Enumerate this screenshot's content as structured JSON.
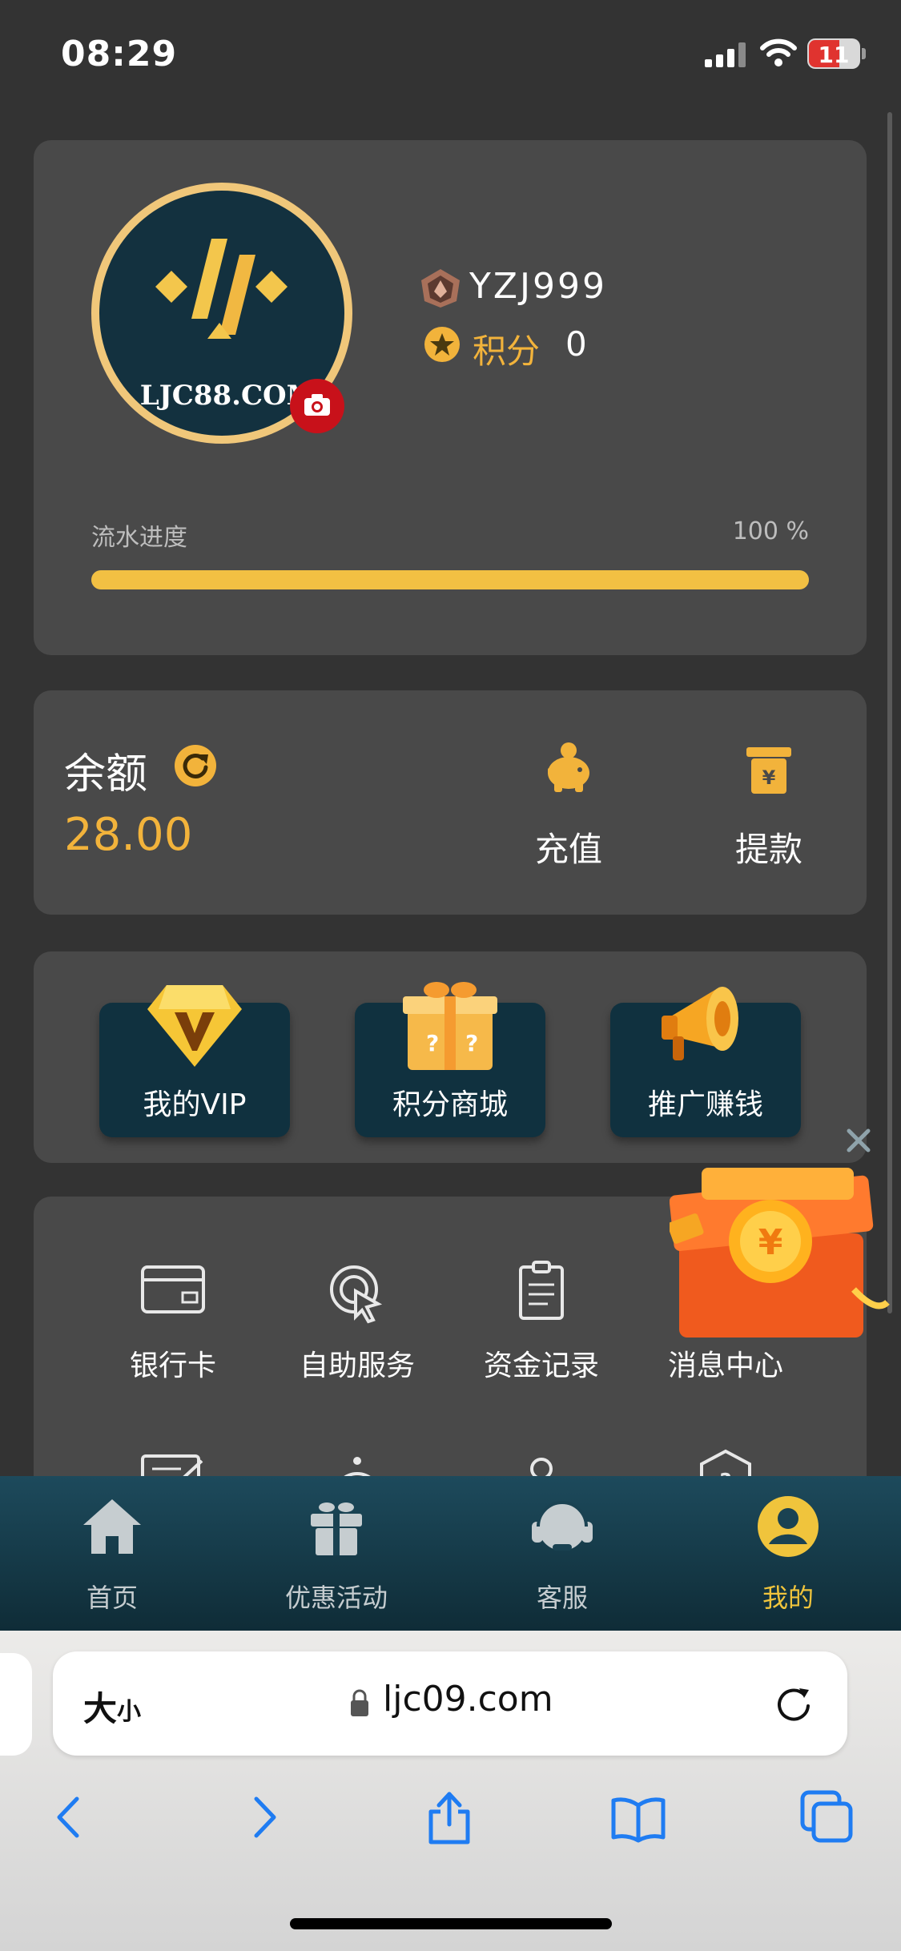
{
  "status_bar": {
    "time": "08:29",
    "battery": "11"
  },
  "profile": {
    "avatar_brand": "LJC88.COM",
    "username": "YZJ999",
    "points_label": "积分",
    "points_value": "0",
    "turnover_label": "流水进度",
    "turnover_percent": "100 %",
    "turnover_progress": 1.0
  },
  "balance": {
    "label": "余额",
    "value": "28.00",
    "deposit_label": "充值",
    "withdraw_label": "提款"
  },
  "features": [
    {
      "label": "我的VIP",
      "icon": "diamond-icon"
    },
    {
      "label": "积分商城",
      "icon": "gift-box-icon"
    },
    {
      "label": "推广赚钱",
      "icon": "megaphone-icon"
    }
  ],
  "menu": [
    {
      "label": "银行卡",
      "icon": "bank-card-icon"
    },
    {
      "label": "自助服务",
      "icon": "self-service-icon"
    },
    {
      "label": "资金记录",
      "icon": "clipboard-icon"
    },
    {
      "label": "消息中心",
      "icon": "message-icon"
    }
  ],
  "bottom_nav": [
    {
      "label": "首页",
      "icon": "home-icon"
    },
    {
      "label": "优惠活动",
      "icon": "gift-icon"
    },
    {
      "label": "客服",
      "icon": "headset-icon"
    },
    {
      "label": "我的",
      "icon": "user-icon",
      "active": true
    }
  ],
  "browser": {
    "text_size_large": "大",
    "text_size_small": "小",
    "url": "ljc09.com"
  },
  "colors": {
    "accent": "#f2b33b",
    "card": "#494949",
    "background": "#333333",
    "tile": "#10313f",
    "nav_active": "#f0c43c"
  }
}
